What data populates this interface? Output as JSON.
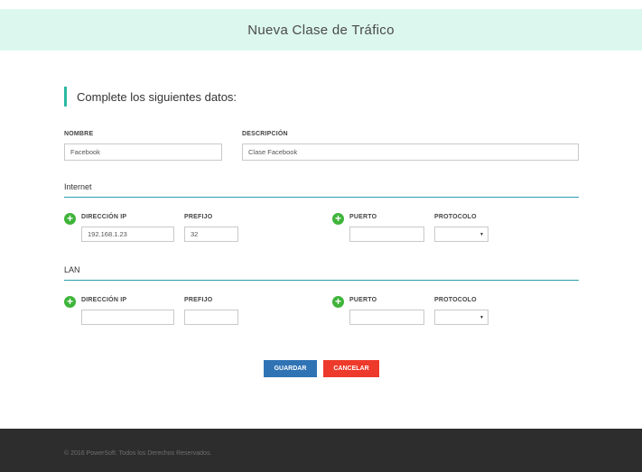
{
  "header": {
    "title": "Nueva Clase de Tráfico"
  },
  "form": {
    "section_title": "Complete los siguientes datos:",
    "nombre_label": "NOMBRE",
    "nombre_value": "Facebook",
    "descripcion_label": "DESCRIPCIÓN",
    "descripcion_value": "Clase Facebook"
  },
  "internet": {
    "title": "Internet",
    "ip_label": "DIRECCIÓN IP",
    "ip_value": "192.168.1.23",
    "prefijo_label": "PREFIJO",
    "prefijo_value": "32",
    "puerto_label": "PUERTO",
    "puerto_value": "",
    "protocolo_label": "PROTOCOLO",
    "protocolo_value": ""
  },
  "lan": {
    "title": "LAN",
    "ip_label": "DIRECCIÓN IP",
    "ip_value": "",
    "prefijo_label": "PREFIJO",
    "prefijo_value": "",
    "puerto_label": "PUERTO",
    "puerto_value": "",
    "protocolo_label": "PROTOCOLO",
    "protocolo_value": ""
  },
  "icons": {
    "add": "plus-circle-icon",
    "dropdown": "caret-down-icon",
    "add_symbol": "+",
    "caret_symbol": "▼"
  },
  "actions": {
    "save_label": "GUARDAR",
    "cancel_label": "CANCELAR"
  },
  "footer": {
    "text": "© 2016 PowerSoft. Todos los Derechos Reservados."
  },
  "colors": {
    "header_bg": "#dcf7ed",
    "accent": "#2bb8a0",
    "divider": "#2b9fae",
    "add_green": "#3fb43a",
    "save_blue": "#2f73b4",
    "cancel_red": "#ee3a2b",
    "footer_bg": "#2d2d2d"
  }
}
